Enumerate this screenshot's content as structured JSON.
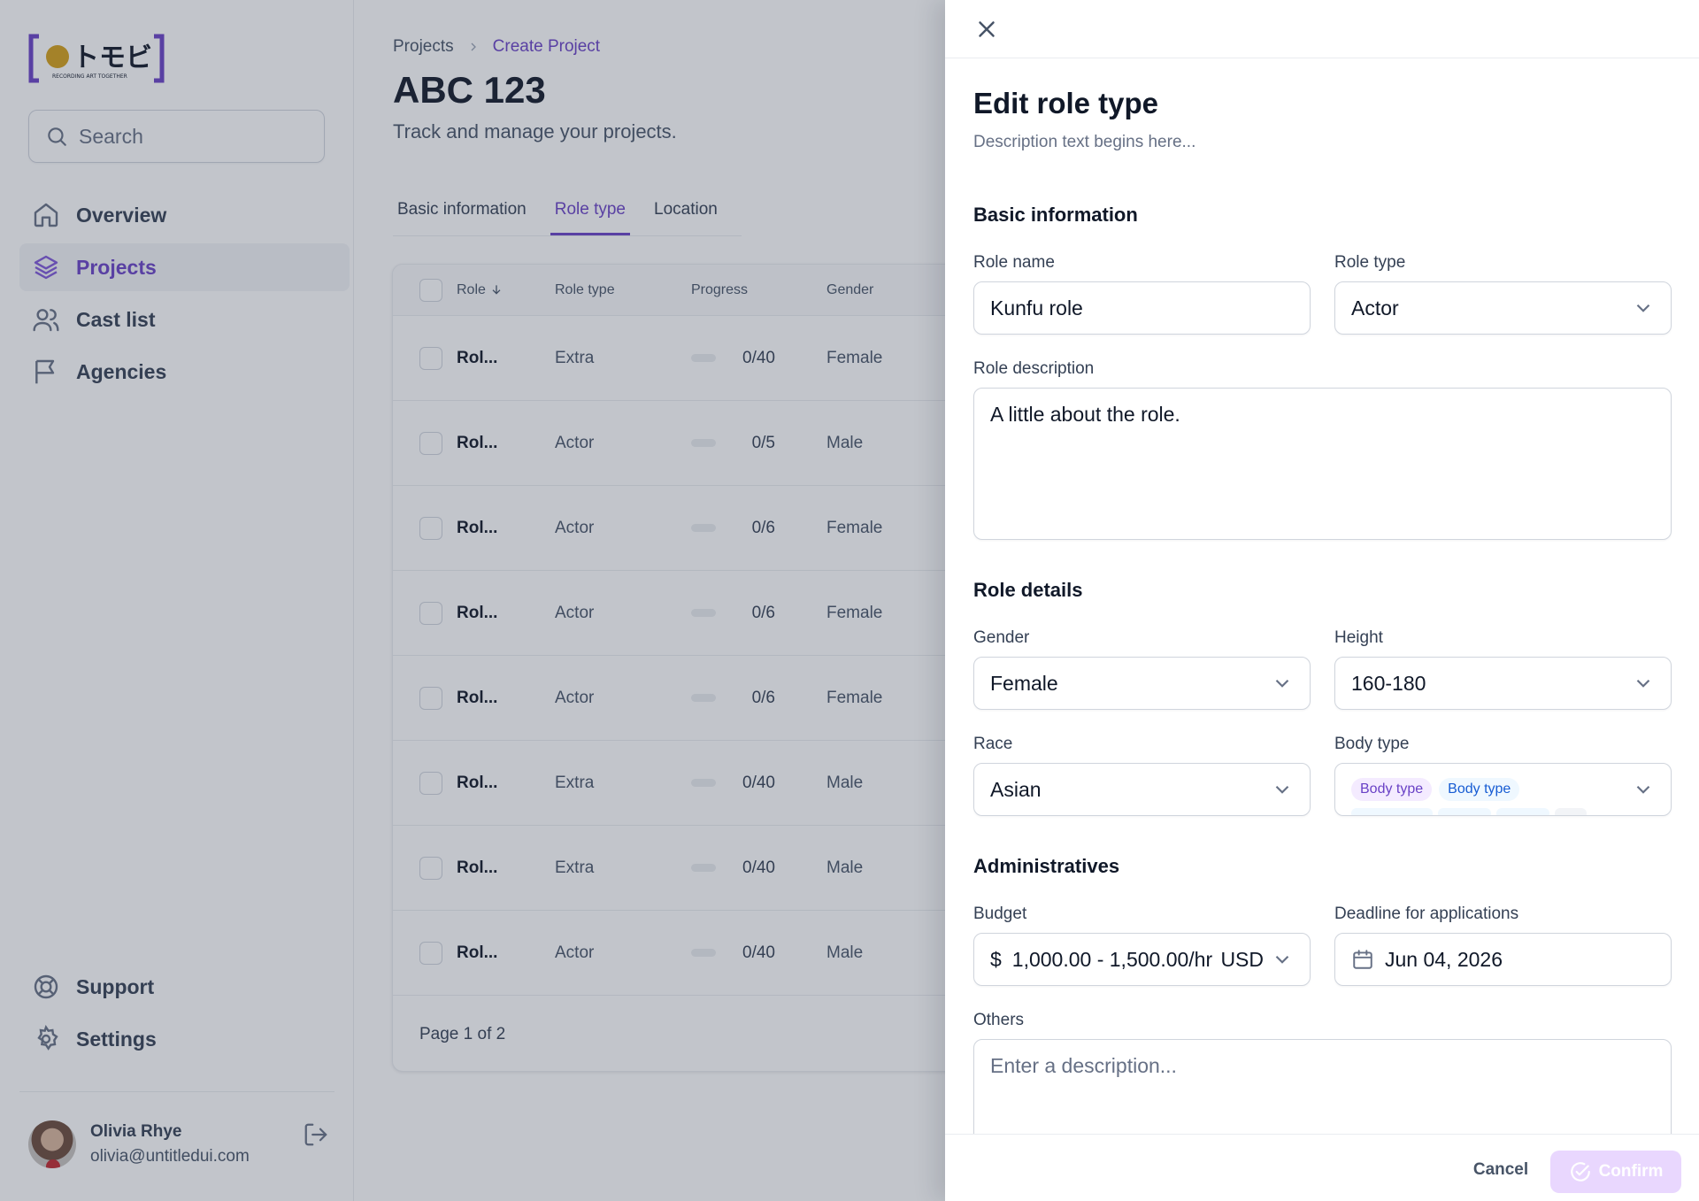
{
  "logo": {
    "brand": "トモビ",
    "tagline": "RECORDING ART TOGETHER"
  },
  "search": {
    "placeholder": "Search",
    "icon": "search-icon"
  },
  "nav": {
    "items": [
      {
        "label": "Overview",
        "icon": "home-icon"
      },
      {
        "label": "Projects",
        "icon": "layers-icon",
        "active": true
      },
      {
        "label": "Cast list",
        "icon": "users-icon"
      },
      {
        "label": "Agencies",
        "icon": "flag-icon"
      }
    ],
    "bottom": [
      {
        "label": "Support",
        "icon": "life-buoy-icon"
      },
      {
        "label": "Settings",
        "icon": "settings-icon"
      }
    ]
  },
  "user": {
    "name": "Olivia Rhye",
    "email": "olivia@untitledui.com"
  },
  "breadcrumb": {
    "parent": "Projects",
    "current": "Create Project"
  },
  "page": {
    "title": "ABC 123",
    "subtitle": "Track and manage your projects."
  },
  "tabs": [
    "Basic information",
    "Role type",
    "Location"
  ],
  "table": {
    "headers": {
      "role": "Role",
      "role_type": "Role type",
      "progress": "Progress",
      "gender": "Gender"
    },
    "rows": [
      {
        "role": "Rol...",
        "type": "Extra",
        "progress": "0/40",
        "gender": "Female"
      },
      {
        "role": "Rol...",
        "type": "Actor",
        "progress": "0/5",
        "gender": "Male"
      },
      {
        "role": "Rol...",
        "type": "Actor",
        "progress": "0/6",
        "gender": "Female"
      },
      {
        "role": "Rol...",
        "type": "Actor",
        "progress": "0/6",
        "gender": "Female"
      },
      {
        "role": "Rol...",
        "type": "Actor",
        "progress": "0/6",
        "gender": "Female"
      },
      {
        "role": "Rol...",
        "type": "Extra",
        "progress": "0/40",
        "gender": "Male"
      },
      {
        "role": "Rol...",
        "type": "Extra",
        "progress": "0/40",
        "gender": "Male"
      },
      {
        "role": "Rol...",
        "type": "Actor",
        "progress": "0/40",
        "gender": "Male"
      }
    ],
    "pagination": "Page 1 of 2"
  },
  "drawer": {
    "title": "Edit role type",
    "description": "Description text begins here...",
    "sections": {
      "basic": "Basic information",
      "details": "Role details",
      "admin": "Administratives"
    },
    "labels": {
      "role_name": "Role name",
      "role_type": "Role type",
      "role_description": "Role description",
      "gender": "Gender",
      "height": "Height",
      "race": "Race",
      "body_type": "Body type",
      "budget": "Budget",
      "deadline": "Deadline for applications",
      "others": "Others"
    },
    "values": {
      "role_name": "Kunfu role",
      "role_type": "Actor",
      "role_description": "A little about the role.",
      "gender": "Female",
      "height": "160-180",
      "race": "Asian",
      "body_type_chips": [
        "Body type",
        "Body type"
      ],
      "budget_symbol": "$",
      "budget": "1,000.00 - 1,500.00/hr",
      "currency": "USD",
      "deadline": "Jun 04, 2026"
    },
    "others_placeholder": "Enter a description...",
    "buttons": {
      "cancel": "Cancel",
      "confirm": "Confirm"
    }
  },
  "colors": {
    "accent": "#6941c6",
    "confirm_disabled": "#e9d7fe",
    "logo_frame": "#6941c6",
    "logo_dot": "#d4a017"
  }
}
